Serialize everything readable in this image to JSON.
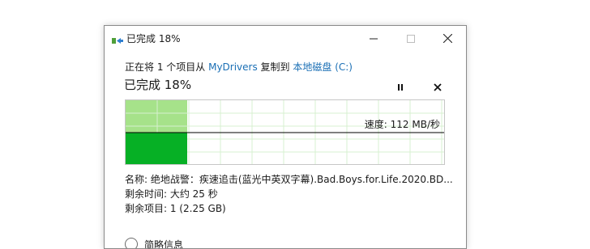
{
  "window": {
    "title": "已完成 18%"
  },
  "copy_line": {
    "prefix": "正在将 1 个项目从 ",
    "source": "MyDrivers",
    "middle": " 复制到 ",
    "destination": "本地磁盘 (C:)"
  },
  "progress": {
    "title": "已完成 18%",
    "percent": 18,
    "speed_text": "速度: 112 MB/秒"
  },
  "info": {
    "name": "名称: 绝地战警：疾速追击(蓝光中英双字幕).Bad.Boys.for.Life.2020.BD...",
    "time_remaining": "剩余时间: 大约 25 秒",
    "items_remaining": "剩余项目: 1 (2.25 GB)"
  },
  "details": {
    "label": "简略信息"
  },
  "icons": {
    "title": "copy-arrow-icon",
    "minimize": "minimize-icon",
    "maximize": "maximize-icon",
    "close": "close-icon",
    "pause": "pause-icon",
    "stop": "stop-icon"
  },
  "colors": {
    "link": "#1a6fb5",
    "progress_light": "#a6e28a",
    "progress_dark": "#06b025",
    "grid": "#d7f0d0"
  }
}
